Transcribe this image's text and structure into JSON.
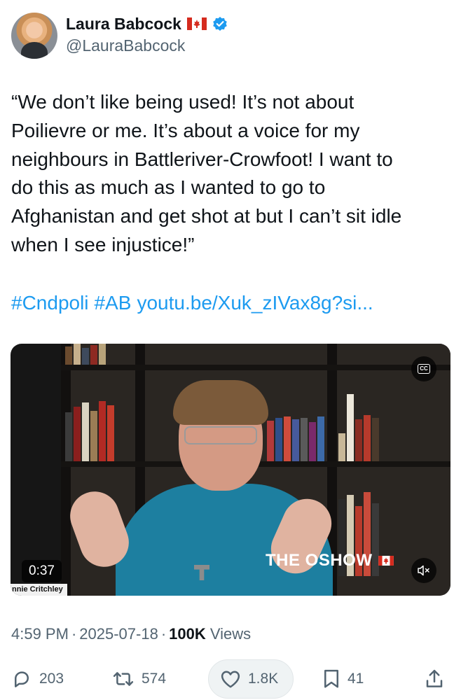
{
  "author": {
    "name": "Laura Babcock",
    "handle": "@LauraBabcock"
  },
  "tweet": {
    "text": "“We don’t like being used! It’s not about\nPoilievre or me. It’s about a voice for my\nneighbours in Battleriver-Crowfoot! I want to\ndo this as much as I wanted to go to\nAfghanistan and get  shot at but I can’t sit idle\nwhen I see injustice!”",
    "hashtags": [
      "#Cndpoli",
      "#AB"
    ],
    "link": "youtu.be/Xuk_zIVax8g?si..."
  },
  "video": {
    "duration": "0:37",
    "caption_name": "nnie Critchley",
    "watermark": "THE OSHOW",
    "cc_label": "CC"
  },
  "meta": {
    "time": "4:59 PM",
    "date": "2025-07-18",
    "views_count": "100K",
    "views_label": "Views",
    "separator": "·"
  },
  "actions": {
    "replies": "203",
    "reposts": "574",
    "likes": "1.8K",
    "bookmarks": "41"
  },
  "colors": {
    "accent": "#1d9bf0",
    "text": "#0f1419",
    "secondary": "#536471",
    "canada_red": "#d52b1e"
  },
  "icons": [
    "canada-flag-icon",
    "verified-badge-icon",
    "closed-captions-icon",
    "mute-icon",
    "reply-icon",
    "repost-icon",
    "like-icon",
    "bookmark-icon",
    "share-icon"
  ]
}
